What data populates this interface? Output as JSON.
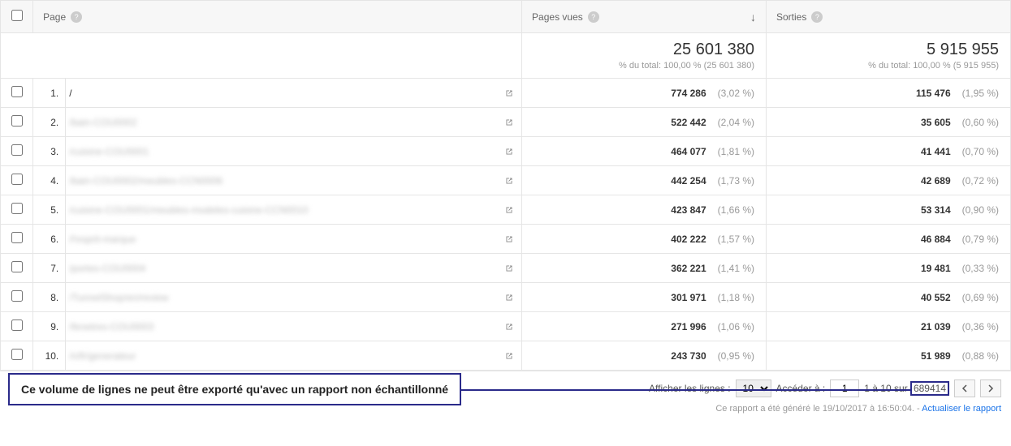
{
  "columns": {
    "page": "Page",
    "pageviews": "Pages vues",
    "exits": "Sorties"
  },
  "summary": {
    "pageviews": {
      "value": "25 601 380",
      "sub": "% du total: 100,00 % (25 601 380)"
    },
    "exits": {
      "value": "5 915 955",
      "sub": "% du total: 100,00 % (5 915 955)"
    }
  },
  "rows": [
    {
      "n": "1.",
      "path": "/",
      "blur": false,
      "pv": "774 286",
      "pv_pct": "(3,02 %)",
      "ex": "115 476",
      "ex_pct": "(1,95 %)"
    },
    {
      "n": "2.",
      "path": "/bain-COU0002",
      "blur": true,
      "pv": "522 442",
      "pv_pct": "(2,04 %)",
      "ex": "35 605",
      "ex_pct": "(0,60 %)"
    },
    {
      "n": "3.",
      "path": "/cuisine-COU0001",
      "blur": true,
      "pv": "464 077",
      "pv_pct": "(1,81 %)",
      "ex": "41 441",
      "ex_pct": "(0,70 %)"
    },
    {
      "n": "4.",
      "path": "/bain-COU0002/meubles-CCN0006",
      "blur": true,
      "pv": "442 254",
      "pv_pct": "(1,73 %)",
      "ex": "42 689",
      "ex_pct": "(0,72 %)"
    },
    {
      "n": "5.",
      "path": "/cuisine-COU0001/meubles-modeles-cuisine-CCN0010",
      "blur": true,
      "pv": "423 847",
      "pv_pct": "(1,66 %)",
      "ex": "53 314",
      "ex_pct": "(0,90 %)"
    },
    {
      "n": "6.",
      "path": "/l'esprit-marque",
      "blur": true,
      "pv": "402 222",
      "pv_pct": "(1,57 %)",
      "ex": "46 884",
      "ex_pct": "(0,79 %)"
    },
    {
      "n": "7.",
      "path": "/portes-COU0004",
      "blur": true,
      "pv": "362 221",
      "pv_pct": "(1,41 %)",
      "ex": "19 481",
      "ex_pct": "(0,33 %)"
    },
    {
      "n": "8.",
      "path": "/TunnelShop/en/review",
      "blur": true,
      "pv": "301 971",
      "pv_pct": "(1,18 %)",
      "ex": "40 552",
      "ex_pct": "(0,69 %)"
    },
    {
      "n": "9.",
      "path": "/fenetres-COU0003",
      "blur": true,
      "pv": "271 996",
      "pv_pct": "(1,06 %)",
      "ex": "21 039",
      "ex_pct": "(0,36 %)"
    },
    {
      "n": "10.",
      "path": "/n/fr/generateur",
      "blur": true,
      "pv": "243 730",
      "pv_pct": "(0,95 %)",
      "ex": "51 989",
      "ex_pct": "(0,88 %)"
    }
  ],
  "pager": {
    "show_label": "Afficher les lignes :",
    "show_value": "10",
    "goto_label": "Accéder à :",
    "goto_value": "1",
    "range": "1 à 10 sur ",
    "total": "689414"
  },
  "callout": "Ce volume de lignes ne peut être exporté qu'avec un rapport non échantillonné",
  "generated": {
    "prefix": "Ce rapport a été généré le 19/10/2017 à 16:50:04. - ",
    "link": "Actualiser le rapport"
  }
}
